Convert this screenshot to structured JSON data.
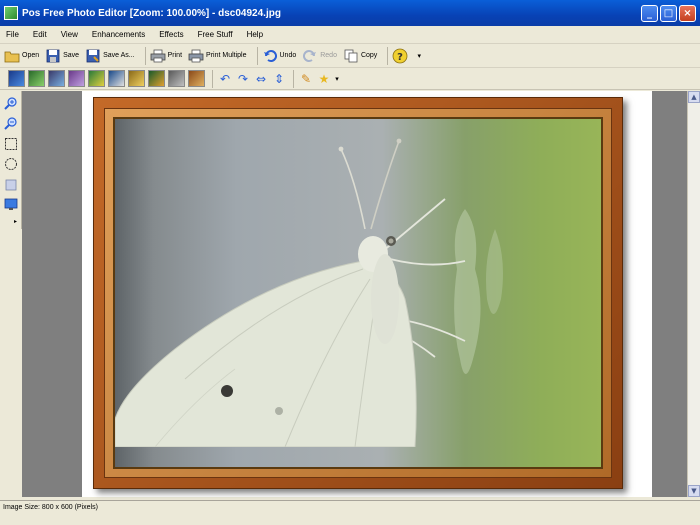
{
  "window": {
    "title": "Pos Free Photo Editor [Zoom: 100.00%] - dsc04924.jpg",
    "minimize_glyph": "_",
    "maximize_glyph": "□",
    "close_glyph": "×"
  },
  "menu": {
    "items": [
      {
        "label": "File"
      },
      {
        "label": "Edit"
      },
      {
        "label": "View"
      },
      {
        "label": "Enhancements"
      },
      {
        "label": "Effects"
      },
      {
        "label": "Free Stuff"
      },
      {
        "label": "Help"
      }
    ]
  },
  "toolbar": {
    "open": "Open",
    "save": "Save",
    "save_as": "Save As...",
    "print": "Print",
    "print_multiple": "Print Multiple",
    "undo": "Undo",
    "redo": "Redo",
    "copy": "Copy"
  },
  "status": {
    "text": "Image Size: 800 x 600 (Pixels)"
  },
  "colors": {
    "titlebar": "#0842b5",
    "frame_outer": "#a85420",
    "frame_inner": "#d08a44",
    "canvas": "#7f7f7f"
  }
}
